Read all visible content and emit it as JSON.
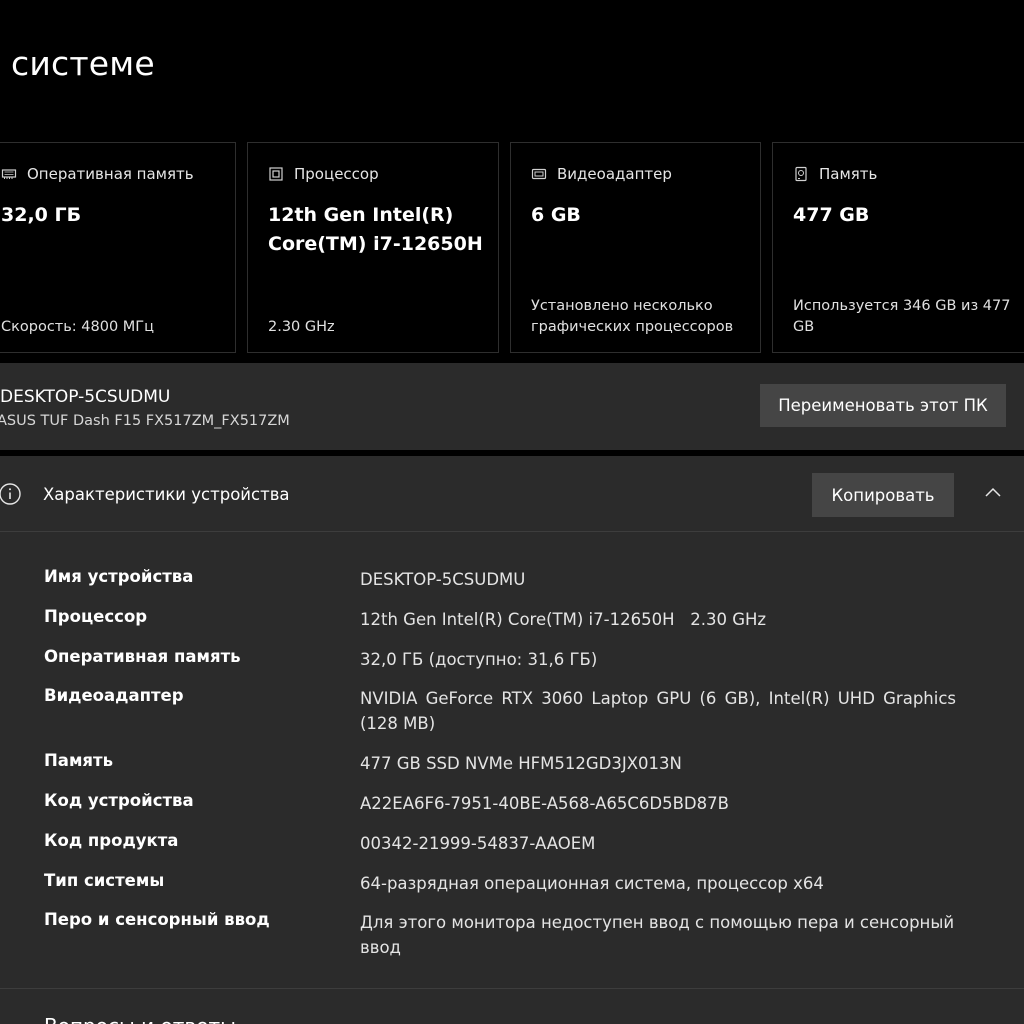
{
  "page": {
    "title": "системе"
  },
  "cards": {
    "ram": {
      "label": "Оперативная память",
      "value": "32,0 ГБ",
      "note": "Скорость: 4800 МГц",
      "icon": "ram-icon"
    },
    "cpu": {
      "label": "Процессор",
      "value": "12th Gen Intel(R) Core(TM) i7-12650H",
      "note": "2.30 GHz",
      "icon": "processor-icon"
    },
    "gpu": {
      "label": "Видеоадаптер",
      "value": "6 GB",
      "note": "Установлено несколько графических процессоров",
      "icon": "graphics-card-icon"
    },
    "storage": {
      "label": "Память",
      "value": "477 GB",
      "note": "Используется 346 GB из 477 GB",
      "icon": "storage-icon"
    }
  },
  "device": {
    "name": "DESKTOP-5CSUDMU",
    "model": "ASUS TUF Dash F15 FX517ZM_FX517ZM",
    "rename_label": "Переименовать этот ПК"
  },
  "specs": {
    "title": "Характеристики устройства",
    "copy_label": "Копировать",
    "rows": [
      {
        "label": "Имя устройства",
        "value": "DESKTOP-5CSUDMU"
      },
      {
        "label": "Процессор",
        "value": "12th Gen Intel(R) Core(TM) i7-12650H   2.30 GHz"
      },
      {
        "label": "Оперативная память",
        "value": "32,0 ГБ (доступно: 31,6 ГБ)"
      },
      {
        "label": "Видеоадаптер",
        "value": "NVIDIA GeForce RTX 3060 Laptop GPU (6 GB), Intel(R) UHD Graphics (128 MB)"
      },
      {
        "label": "Память",
        "value": "477 GB SSD NVMe HFM512GD3JX013N"
      },
      {
        "label": "Код устройства",
        "value": "A22EA6F6-7951-40BE-A568-A65C6D5BD87B"
      },
      {
        "label": "Код продукта",
        "value": "00342-21999-54837-AAOEM"
      },
      {
        "label": "Тип системы",
        "value": "64-разрядная операционная система, процессор x64"
      },
      {
        "label": "Перо и сенсорный ввод",
        "value": "Для этого монитора недоступен ввод с помощью пера и сенсорный ввод"
      }
    ]
  },
  "faq": {
    "title": "Вопросы и ответы"
  },
  "colors": {
    "background": "#000000",
    "panel": "#2b2b2b",
    "button": "#454545",
    "text": "#ffffff"
  }
}
